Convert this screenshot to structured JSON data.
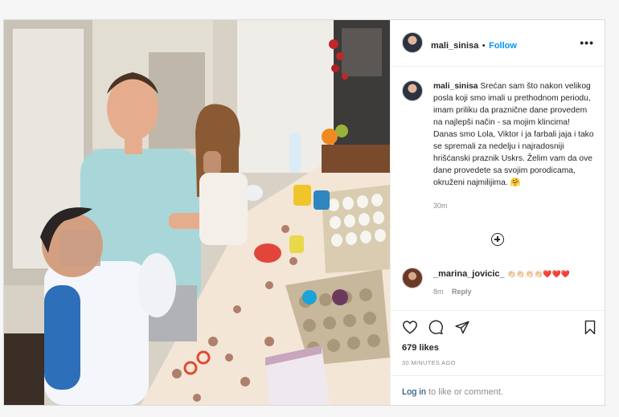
{
  "post": {
    "username": "mali_sinisa",
    "separator": "•",
    "follow_label": "Follow",
    "more_label": "•••",
    "caption": "Srećan sam što nakon velikog posla koji smo imali u prethodnom periodu, imam priliku da praznične dane provedem na najlepši način - sa mojim klincima! Danas smo Lola, Viktor i ja farbali jaja i tako se spremali za nedelju i najradosniji hrišćanski praznik Uskrs. Želim vam da ove dane provedete sa svojim porodicama, okruženi najmilijima. 🤗",
    "caption_time": "30m",
    "photo_label": "Family dyeing Easter eggs at a kitchen table"
  },
  "comment": {
    "username": "_marina_jovicic_",
    "text": "👏🏻👏🏻👏🏻👏🏻❤️❤️❤️",
    "time": "8m",
    "reply_label": "Reply"
  },
  "actions": {
    "likes": "679 likes",
    "time_ago": "30 MINUTES AGO",
    "login_link": "Log in",
    "login_rest": " to like or comment."
  }
}
